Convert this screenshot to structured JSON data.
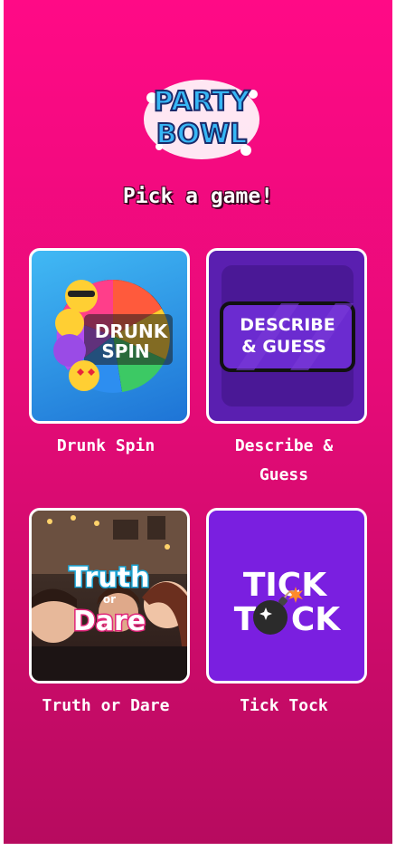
{
  "logo": {
    "line1": "PARTY",
    "line2": "BOWL"
  },
  "heading": "Pick a game!",
  "games": [
    {
      "label": "Drunk Spin",
      "art_line1": "DRUNK",
      "art_line2": "SPIN"
    },
    {
      "label": "Describe & Guess",
      "label_line1": "Describe &",
      "label_line2": "Guess",
      "art_line1": "DESCRIBE",
      "art_line2": "& GUESS"
    },
    {
      "label": "Truth or Dare",
      "art_line1": "Truth",
      "art_or": "or",
      "art_line2": "Dare"
    },
    {
      "label": "Tick Tock",
      "art_line1": "TICK",
      "art_line2_a": "T",
      "art_line2_b": "CK"
    }
  ],
  "colors": {
    "background_top": "#ff0a86",
    "background_bottom": "#b70b5f",
    "card_border": "#ffffff",
    "drunk_spin_bg": "#2e8be6",
    "describe_bg": "#5a1fb0",
    "tick_tock_bg": "#7a1fe0"
  }
}
